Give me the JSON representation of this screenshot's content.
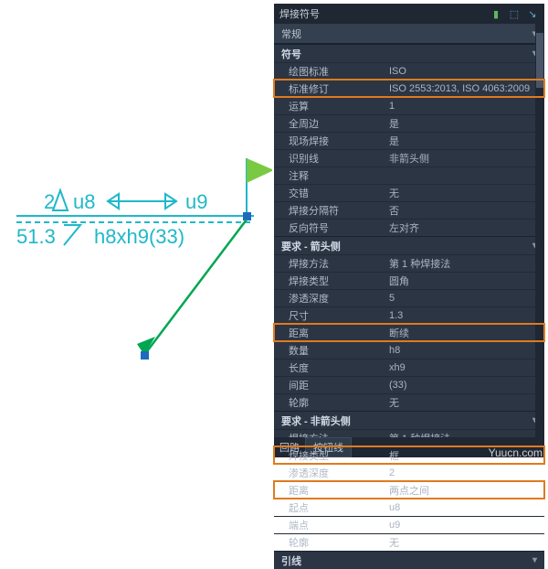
{
  "canvas": {
    "text_top_left": "2",
    "text_top_mid": "u8",
    "text_top_right": "u9",
    "text_bot_left": "51.3",
    "text_bot_right": "h8xh9(33)",
    "color_main": "#1fb8c9",
    "color_flag": "#7ac943",
    "color_arrow": "#00a651"
  },
  "panel": {
    "title": "焊接符号",
    "dropdown": "常规",
    "footer_label": "回路",
    "footer_btn": "按钮线",
    "sections": {
      "symbol": {
        "header": "符号",
        "rows": [
          {
            "lbl": "绘图标准",
            "val": "ISO",
            "hl": false
          },
          {
            "lbl": "标准修订",
            "val": "ISO 2553:2013, ISO 4063:2009",
            "hl": true
          },
          {
            "lbl": "运算",
            "val": "1",
            "hl": false
          },
          {
            "lbl": "全周边",
            "val": "是",
            "hl": false
          },
          {
            "lbl": "现场焊接",
            "val": "是",
            "hl": false
          },
          {
            "lbl": "识别线",
            "val": "非箭头侧",
            "hl": false
          },
          {
            "lbl": "注释",
            "val": "",
            "hl": false
          },
          {
            "lbl": "交错",
            "val": "无",
            "hl": false
          },
          {
            "lbl": "焊接分隔符",
            "val": "否",
            "hl": false
          },
          {
            "lbl": "反向符号",
            "val": "左对齐",
            "hl": false
          }
        ]
      },
      "req_arrow": {
        "header": "要求 - 箭头侧",
        "rows": [
          {
            "lbl": "焊接方法",
            "val": "第 1 种焊接法",
            "hl": false
          },
          {
            "lbl": "焊接类型",
            "val": "圆角",
            "hl": false
          },
          {
            "lbl": "渗透深度",
            "val": "5",
            "hl": false
          },
          {
            "lbl": "尺寸",
            "val": "1.3",
            "hl": false
          },
          {
            "lbl": "距离",
            "val": "断续",
            "hl": true
          },
          {
            "lbl": "数量",
            "val": "h8",
            "hl": false
          },
          {
            "lbl": "长度",
            "val": "xh9",
            "hl": false
          },
          {
            "lbl": "间距",
            "val": "(33)",
            "hl": false
          },
          {
            "lbl": "轮廓",
            "val": "无",
            "hl": false
          }
        ]
      },
      "req_other": {
        "header": "要求 - 非箭头侧",
        "rows": [
          {
            "lbl": "焊接方法",
            "val": "第 1 种焊接法",
            "hl": false
          },
          {
            "lbl": "焊接类型",
            "val": "框",
            "hl": true
          },
          {
            "lbl": "渗透深度",
            "val": "2",
            "hl": false
          },
          {
            "lbl": "距离",
            "val": "两点之间",
            "hl": true
          },
          {
            "lbl": "起点",
            "val": "u8",
            "hl": false
          },
          {
            "lbl": "端点",
            "val": "u9",
            "hl": false
          },
          {
            "lbl": "轮廓",
            "val": "无",
            "hl": false
          }
        ]
      },
      "leader": {
        "header": "引线"
      }
    }
  },
  "watermark": "Yuucn.com"
}
